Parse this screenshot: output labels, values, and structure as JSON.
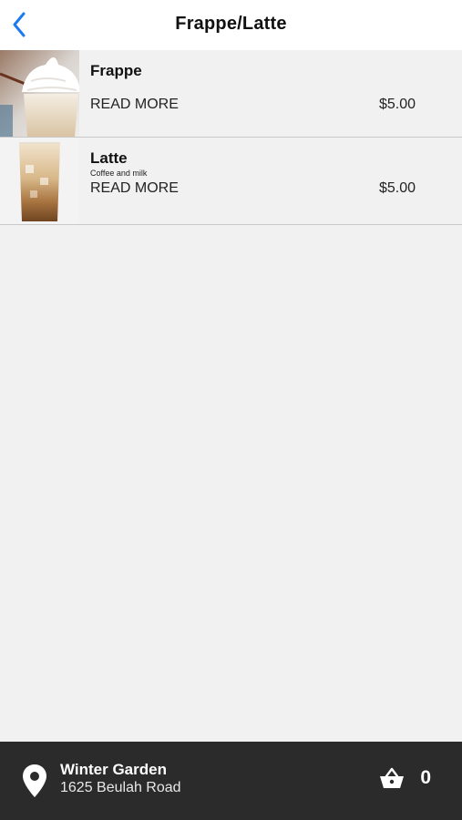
{
  "header": {
    "title": "Frappe/Latte",
    "back_icon": "chevron-left-icon",
    "accent_color": "#1a7cf0"
  },
  "menu_items": [
    {
      "name": "Frappe",
      "description": "",
      "read_more": "READ MORE",
      "price": "$5.00"
    },
    {
      "name": "Latte",
      "description": "Coffee and milk",
      "read_more": "READ MORE",
      "price": "$5.00"
    }
  ],
  "footer": {
    "store_name": "Winter Garden",
    "address": "1625 Beulah Road",
    "location_icon": "map-pin-icon",
    "cart_icon": "basket-icon",
    "cart_count": "0",
    "background": "#2b2b2b"
  }
}
